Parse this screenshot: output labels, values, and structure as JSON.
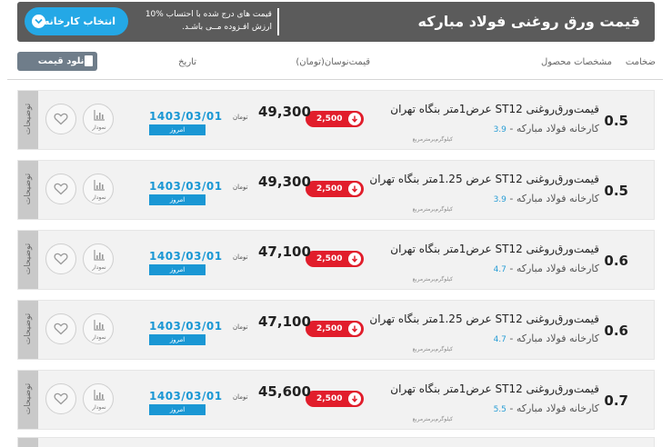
{
  "header": {
    "title": "قیمت ورق روغنی فولاد مبارکه",
    "notice": "قیمت های درج شده با احتساب %10 ارزش افـزوده مــی باشـد.",
    "factory_button": "انتخاب کارخانه"
  },
  "columns": {
    "thickness": "ضخامت",
    "specs": "مشخصات محصول",
    "price": "قیمت‌نوسان(تومان)",
    "date": "تاریخ",
    "download": "دانلود قیمت"
  },
  "colors": {
    "header_bg": "#5b5b5b",
    "accent_blue": "#24a8e6",
    "change_red": "#e11d2b",
    "row_bg": "#f2f2f2",
    "download_btn": "#6f7d8a"
  },
  "icons": [
    "chevron-down-icon",
    "document-icon",
    "arrow-down-icon",
    "bar-chart-icon",
    "heart-icon"
  ],
  "rows": [
    {
      "thickness": "0.5",
      "name": "قیمت‌ورق‌روغنی ST12 عرض1متر بنگاه تهران",
      "factory": "کارخانه فولاد مبارکه",
      "weight": "3.9",
      "weight_unit": "کیلوگرم‌بر‌مترمربع",
      "change": "2,500",
      "price": "49,300",
      "price_unit": "تومان",
      "date": "1403/03/01",
      "today": "امروز",
      "chart_label": "نمودار",
      "desc_tab": "توضیحات"
    },
    {
      "thickness": "0.5",
      "name": "قیمت‌ورق‌روغنی ST12 عرض 1.25متر بنگاه تهران",
      "factory": "کارخانه فولاد مبارکه",
      "weight": "3.9",
      "weight_unit": "کیلوگرم‌بر‌مترمربع",
      "change": "2,500",
      "price": "49,300",
      "price_unit": "تومان",
      "date": "1403/03/01",
      "today": "امروز",
      "chart_label": "نمودار",
      "desc_tab": "توضیحات"
    },
    {
      "thickness": "0.6",
      "name": "قیمت‌ورق‌روغنی ST12 عرض1متر بنگاه تهران",
      "factory": "کارخانه فولاد مبارکه",
      "weight": "4.7",
      "weight_unit": "کیلوگرم‌بر‌مترمربع",
      "change": "2,500",
      "price": "47,100",
      "price_unit": "تومان",
      "date": "1403/03/01",
      "today": "امروز",
      "chart_label": "نمودار",
      "desc_tab": "توضیحات"
    },
    {
      "thickness": "0.6",
      "name": "قیمت‌ورق‌روغنی ST12 عرض 1.25متر بنگاه تهران",
      "factory": "کارخانه فولاد مبارکه",
      "weight": "4.7",
      "weight_unit": "کیلوگرم‌بر‌مترمربع",
      "change": "2,500",
      "price": "47,100",
      "price_unit": "تومان",
      "date": "1403/03/01",
      "today": "امروز",
      "chart_label": "نمودار",
      "desc_tab": "توضیحات"
    },
    {
      "thickness": "0.7",
      "name": "قیمت‌ورق‌روغنی ST12 عرض1متر بنگاه تهران",
      "factory": "کارخانه فولاد مبارکه",
      "weight": "5.5",
      "weight_unit": "کیلوگرم‌بر‌مترمربع",
      "change": "2,500",
      "price": "45,600",
      "price_unit": "تومان",
      "date": "1403/03/01",
      "today": "امروز",
      "chart_label": "نمودار",
      "desc_tab": "توضیحات"
    }
  ]
}
